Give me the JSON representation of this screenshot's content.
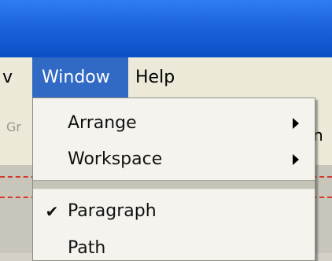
{
  "menubar": {
    "prev_label": "v",
    "window_label": "Window",
    "help_label": "Help"
  },
  "background_toolbar": {
    "left_fragment": "Gr",
    "right_fragment": "n"
  },
  "window_menu": {
    "items": [
      {
        "label": "Arrange",
        "submenu": true
      },
      {
        "label": "Workspace",
        "submenu": true
      },
      {
        "label": "Paragraph",
        "checked": true,
        "check_glyph": "✔"
      },
      {
        "label": "Path",
        "partially_visible": true
      }
    ]
  },
  "colors": {
    "titlebar": "#1c63dc",
    "menu_highlight": "#316ac5",
    "guide_dash": "#d33a2c"
  }
}
